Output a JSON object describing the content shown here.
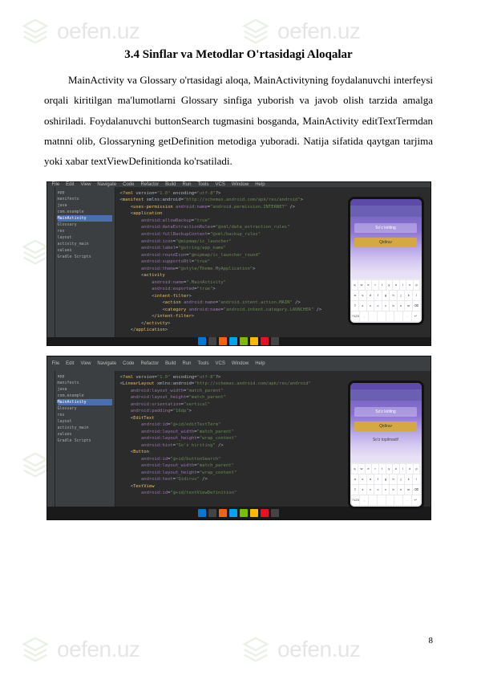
{
  "heading": "3.4 Sinflar va Metodlar O'rtasidagi Aloqalar",
  "paragraph": "MainActivity va Glossary o'rtasidagi aloqa, MainActivityning foydalanuvchi interfeysi orqali kiritilgan ma'lumotlarni Glossary sinfiga yuborish va javob olish tarzida amalga oshiriladi. Foydalanuvchi buttonSearch tugmasini bosganda, MainActivity editTextTermdan matnni olib, Glossaryning getDefinition metodiga yuboradi. Natija sifatida qaytgan tarjima yoki xabar textViewDefinitionda ko'rsatiladi.",
  "page_number": "8",
  "ide": {
    "menu": [
      "File",
      "Edit",
      "View",
      "Navigate",
      "Code",
      "Refactor",
      "Build",
      "Run",
      "Tools",
      "VCS",
      "Window",
      "Help"
    ],
    "tree_items": [
      "app",
      "manifests",
      "java",
      "com.example",
      "MainActivity",
      "Glossary",
      "res",
      "layout",
      "activity_main",
      "values",
      "Gradle Scripts"
    ],
    "code1": [
      "<?xml version=\"1.0\" encoding=\"utf-8\"?>",
      "<manifest xmlns:android=\"http://schemas.android.com/apk/res/android\">",
      "    <uses-permission android:name=\"android.permission.INTERNET\" />",
      "",
      "    <application",
      "        android:allowBackup=\"true\"",
      "        android:dataExtractionRules=\"@xml/data_extraction_rules\"",
      "        android:fullBackupContent=\"@xml/backup_rules\"",
      "        android:icon=\"@mipmap/ic_launcher\"",
      "        android:label=\"@string/app_name\"",
      "        android:roundIcon=\"@mipmap/ic_launcher_round\"",
      "        android:supportsRtl=\"true\"",
      "        android:theme=\"@style/Theme.MyApplication\">",
      "        <activity",
      "            android:name=\".MainActivity\"",
      "            android:exported=\"true\">",
      "            <intent-filter>",
      "                <action android:name=\"android.intent.action.MAIN\" />",
      "                <category android:name=\"android.intent.category.LAUNCHER\" />",
      "            </intent-filter>",
      "        </activity>",
      "    </application>"
    ],
    "code2": [
      "<?xml version=\"1.0\" encoding=\"utf-8\"?>",
      "<LinearLayout xmlns:android=\"http://schemas.android.com/apk/res/android\"",
      "    android:layout_width=\"match_parent\"",
      "    android:layout_height=\"match_parent\"",
      "    android:orientation=\"vertical\"",
      "    android:padding=\"16dp\">",
      "",
      "    <EditText",
      "        android:id=\"@+id/editTextTerm\"",
      "        android:layout_width=\"match_parent\"",
      "        android:layout_height=\"wrap_content\"",
      "        android:hint=\"So'z kiriting\" />",
      "",
      "    <Button",
      "        android:id=\"@+id/buttonSearch\"",
      "        android:layout_width=\"match_parent\"",
      "        android:layout_height=\"wrap_content\"",
      "        android:text=\"Qidiruv\" />",
      "",
      "    <TextView",
      "        android:id=\"@+id/textViewDefinition\""
    ]
  },
  "emulator": {
    "input_hint": "So'z kiriting",
    "button_label": "Qidiruv",
    "result_text": "So'z topilmadi!",
    "keyboard_rows": [
      [
        "q",
        "w",
        "e",
        "r",
        "t",
        "y",
        "u",
        "i",
        "o",
        "p"
      ],
      [
        "a",
        "s",
        "d",
        "f",
        "g",
        "h",
        "j",
        "k",
        "l"
      ],
      [
        "⇧",
        "z",
        "x",
        "c",
        "v",
        "b",
        "n",
        "m",
        "⌫"
      ],
      [
        "?123",
        ",",
        "",
        "",
        "",
        "",
        ".",
        "↵"
      ]
    ]
  },
  "watermark": "oefen.uz"
}
